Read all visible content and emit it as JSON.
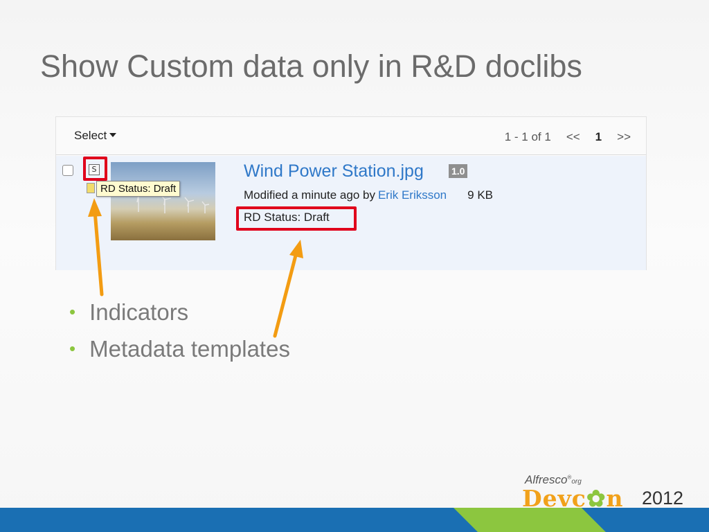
{
  "slide": {
    "title": "Show Custom data only in R&D doclibs",
    "bullets": [
      "Indicators",
      "Metadata templates"
    ],
    "bullet_glyph": "•"
  },
  "doclib": {
    "toolbar": {
      "select_label": "Select",
      "paging": {
        "count": "1 - 1 of 1",
        "prev": "<<",
        "current": "1",
        "next": ">>"
      }
    },
    "document": {
      "indicator_letter": "S",
      "tooltip": "RD Status: Draft",
      "name": "Wind Power Station.jpg",
      "version": "1.0",
      "modified_text": "Modified a minute ago by",
      "author": "Erik Eriksson",
      "size": "9 KB",
      "rd_status": "RD Status: Draft"
    }
  },
  "footer": {
    "brand": "Alfresco",
    "brand_suffix": "org",
    "event_prefix": "Devc",
    "event_suffix": "n",
    "year": "2012"
  },
  "colors": {
    "highlight": "#e0001b",
    "arrow": "#f39c12",
    "link": "#2f78c8",
    "bullet": "#8cc63f",
    "footer_blue": "#1a6fb3",
    "footer_green": "#8cc63f"
  }
}
